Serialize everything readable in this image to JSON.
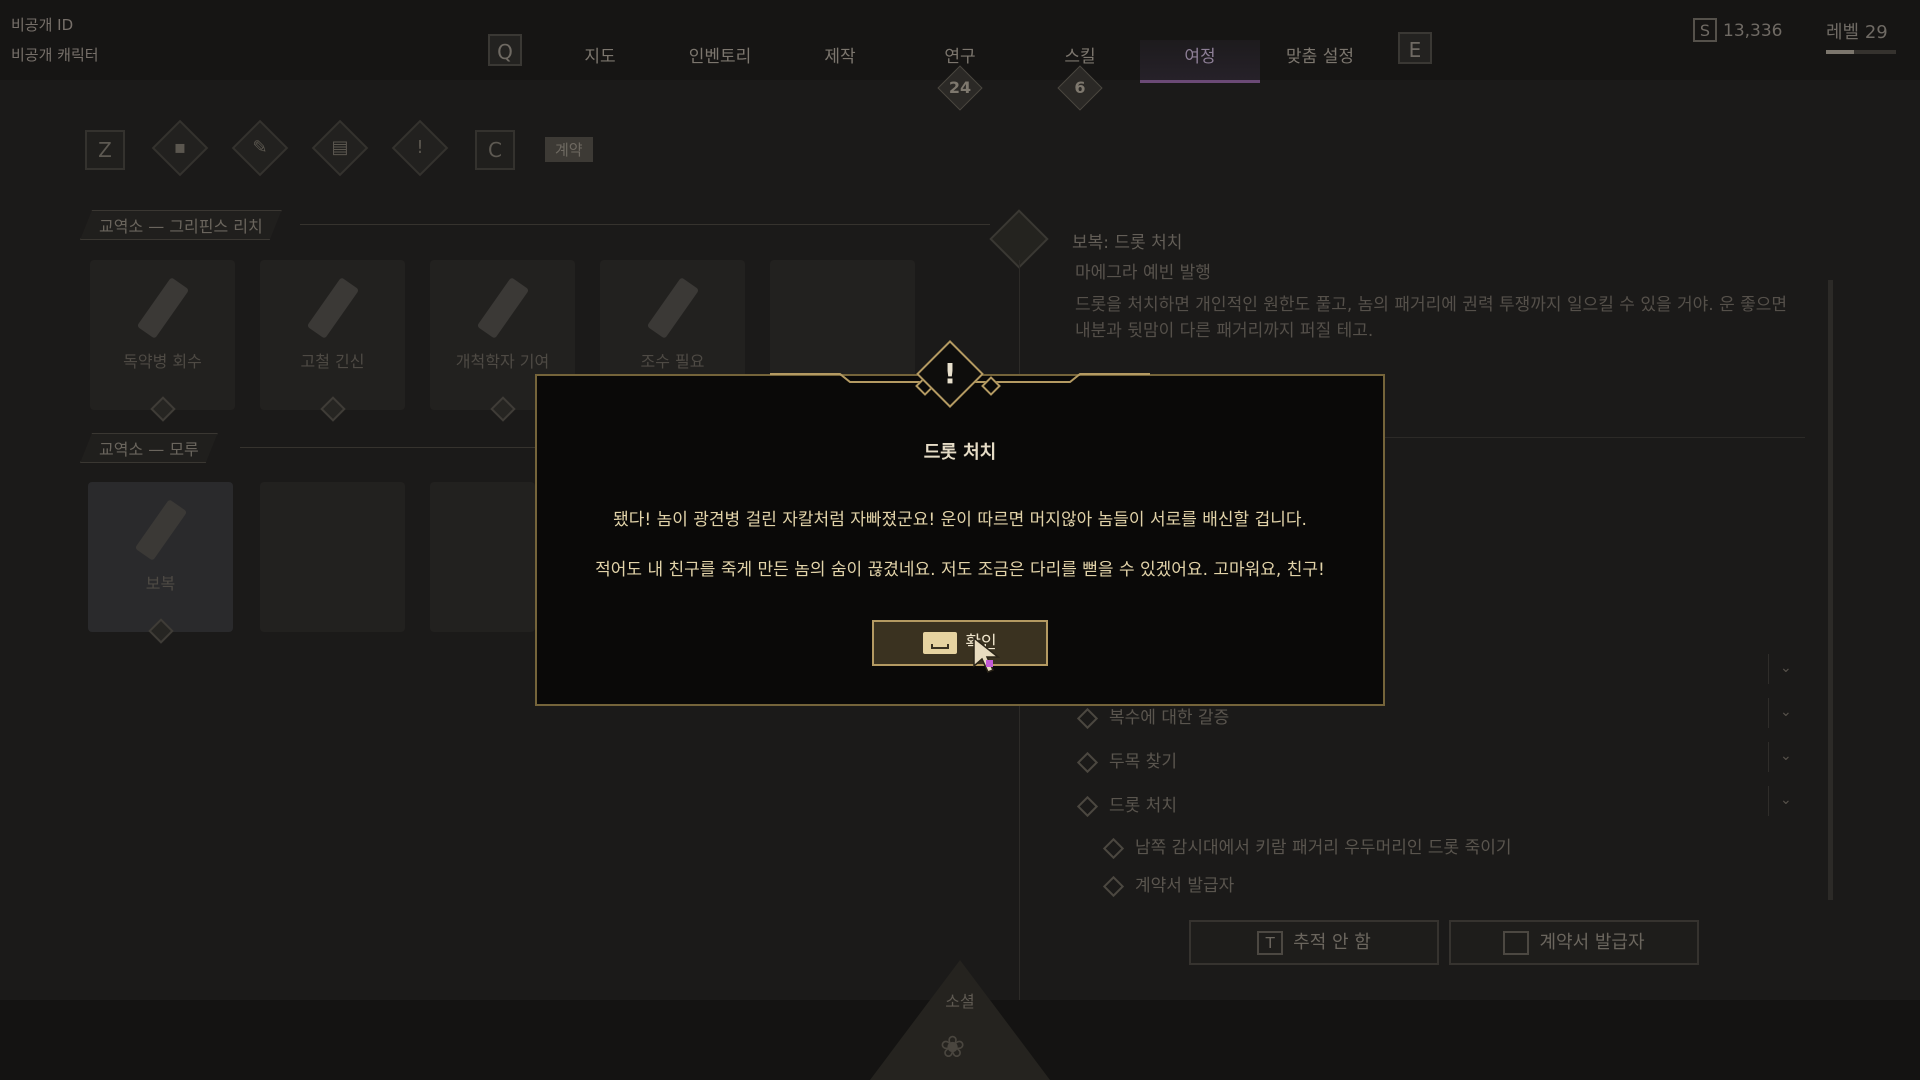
{
  "account": {
    "id_label": "비공개 ID",
    "character_label": "비공개 캐릭터"
  },
  "nav": {
    "left_key": "Q",
    "right_key": "E",
    "tabs": [
      {
        "label": "지도"
      },
      {
        "label": "인벤토리"
      },
      {
        "label": "제작"
      },
      {
        "label": "연구",
        "badge": "24"
      },
      {
        "label": "스킬",
        "badge": "6"
      },
      {
        "label": "여정",
        "active": true
      },
      {
        "label": "맞춤 설정"
      }
    ]
  },
  "currency": {
    "icon": "S",
    "amount": "13,336"
  },
  "level": {
    "label": "레벨 29",
    "progress": 0.4
  },
  "subnav": {
    "left_key": "Z",
    "right_key": "C",
    "contract_tag": "계약"
  },
  "left": {
    "section1": {
      "header": "교역소 — 그리핀스 리치",
      "cards": [
        {
          "name": "독약병 회수"
        },
        {
          "name": "고철 긴신"
        },
        {
          "name": "개척학자 기여"
        },
        {
          "name": "조수 필요"
        }
      ]
    },
    "section2": {
      "header": "교역소 — 모루",
      "cards": [
        {
          "name": "보복"
        }
      ]
    }
  },
  "right": {
    "title": "보복: 드롯 처치",
    "subtitle": "마에그라 예빈 발행",
    "description": "드롯을 처치하면 개인적인 원한도 풀고, 놈의 패거리에 권력 투쟁까지 일으킬 수 있을 거야. 운 좋으면 내분과 뒷맘이 다른 패거리까지 퍼질 테고.",
    "tasks": [
      {
        "label": "복수에 대한 갈증"
      },
      {
        "label": "두목 찾기"
      },
      {
        "label": "드롯 처치"
      }
    ],
    "subtasks": [
      {
        "label": "남쪽 감시대에서 키람 패거리 우두머리인 드롯 죽이기"
      },
      {
        "label": "계약서 발급자"
      }
    ],
    "buttons": {
      "track_key": "T",
      "track_label": "추적 안 함",
      "issuer_label": "계약서 발급자"
    }
  },
  "social": {
    "label": "소셜"
  },
  "modal": {
    "icon": "!",
    "title": "드롯 처치",
    "line1": "됐다! 놈이 광견병 걸린 자칼처럼 자빠졌군요! 운이 따르면 머지않아 놈들이 서로를 배신할 겁니다.",
    "line2": "적어도 내 친구를 죽게 만든 놈의 숨이 끊겼네요. 저도 조금은 다리를 뻗을 수 있겠어요. 고마워요, 친구!",
    "confirm_label": "확인"
  }
}
